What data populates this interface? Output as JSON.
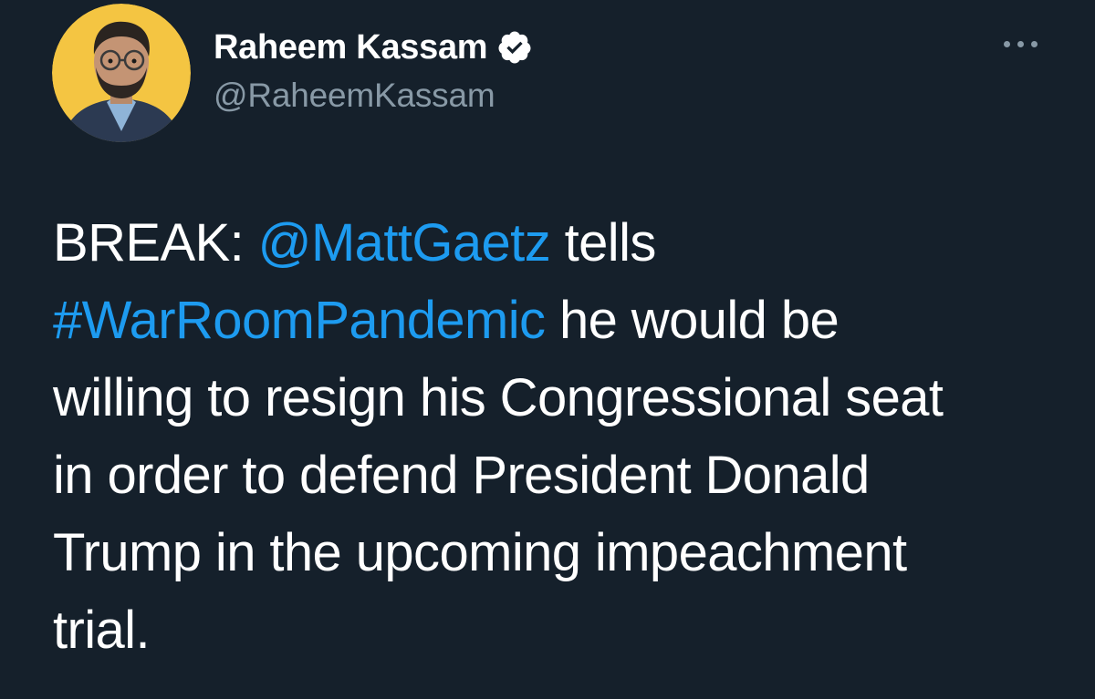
{
  "author": {
    "display_name": "Raheem Kassam",
    "handle": "@RaheemKassam",
    "verified": true,
    "avatar_background": "#f4c542"
  },
  "menu": {
    "icon": "more-horizontal-icon"
  },
  "tweet": {
    "line1": {
      "prefix": "BREAK: ",
      "mention": "@MattGaetz",
      "suffix": " tells"
    },
    "line2": {
      "hashtag": "#WarRoomPandemic",
      "suffix": " he would be"
    },
    "line3": "willing to resign his Congressional seat",
    "line4": "in order to defend President Donald",
    "line5": "Trump in the upcoming impeachment",
    "line6": "trial."
  },
  "colors": {
    "background": "#15202b",
    "text": "#ffffff",
    "secondary_text": "#8899a6",
    "link": "#1d9bf0"
  }
}
